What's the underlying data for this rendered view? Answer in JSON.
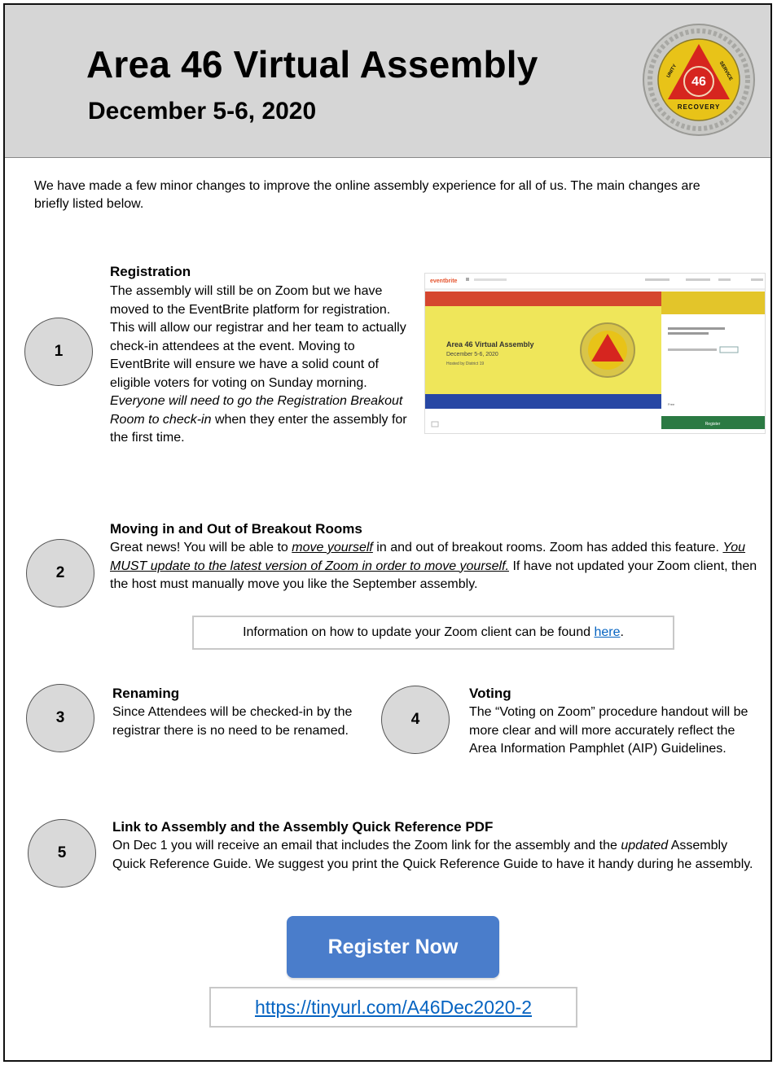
{
  "header": {
    "title": "Area 46 Virtual Assembly",
    "date": "December 5-6, 2020",
    "seal_text": {
      "left": "UNITY",
      "right": "SERVICE",
      "bottom": "RECOVERY",
      "center": "46"
    }
  },
  "intro": "We have made a few minor changes to improve the online assembly experience for all of us. The main changes are briefly listed below.",
  "sections": [
    {
      "number": "1",
      "title": "Registration",
      "body_plain": "The assembly will still be on Zoom but we have moved to the EventBrite platform for registration.  This will allow our registrar and her team to actually check-in attendees at the event.  Moving to EventBrite will ensure we have a solid count of eligible voters for voting on Sunday morning. ",
      "body_italic": "Everyone will need to go the Registration Breakout Room to check-in",
      "body_end": " when they enter the assembly for the first time."
    },
    {
      "number": "2",
      "title": "Moving in and Out of Breakout Rooms",
      "body_a": "Great news! You will be able to ",
      "body_a_emph": "move yourself",
      "body_b": " in and out of breakout rooms. Zoom has added this feature. ",
      "body_b_emph": "You MUST update to the latest version of Zoom in order to move yourself.",
      "body_c": " If have not updated your Zoom client, then the host must manually move you like the September assembly."
    },
    {
      "number": "3",
      "title": "Renaming",
      "body": "Since Attendees will be checked-in by the registrar there is no need to be renamed."
    },
    {
      "number": "4",
      "title": "Voting",
      "body": "The “Voting on Zoom” procedure handout will be more clear and will more accurately reflect the Area Information Pamphlet (AIP) Guidelines."
    },
    {
      "number": "5",
      "title": "Link to Assembly and the Assembly Quick Reference PDF",
      "body_a": "On Dec 1 you will receive an email that includes the Zoom link for the assembly and the ",
      "body_italic": "updated",
      "body_b": " Assembly Quick Reference Guide. We suggest you print the Quick Reference Guide to have it handy during he assembly."
    }
  ],
  "eventbrite_screenshot": {
    "brand": "eventbrite",
    "event_title": "Area 46 Virtual Assembly",
    "event_date": "December 5-6, 2020",
    "hosted_by": "Hosted by District 19",
    "side_title": "Area 46 Virtual Assembly (December 2020)",
    "price": "Free",
    "register_label": "Register"
  },
  "info_box": {
    "text": "Information on how to update your Zoom client can be found ",
    "link": "here",
    "end": "."
  },
  "register_button": "Register Now",
  "url": "https://tinyurl.com/A46Dec2020-2",
  "colors": {
    "header_bg": "#d6d6d6",
    "button_blue": "#4a7dcb",
    "link_blue": "#0563c1"
  }
}
